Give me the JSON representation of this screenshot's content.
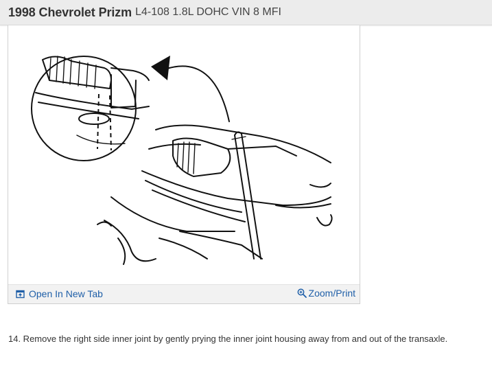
{
  "header": {
    "vehicle": "1998 Chevrolet Prizm",
    "engine": "L4-108 1.8L DOHC VIN 8 MFI"
  },
  "figure": {
    "open_in_new_tab_label": "Open In New Tab",
    "zoom_print_label": "Zoom/Print",
    "open_icon": "open-in-new-tab-icon",
    "zoom_icon": "magnifier-plus-icon"
  },
  "content": {
    "step_text": "14. Remove the right side inner joint by gently prying the inner joint housing away from and out of the transaxle."
  },
  "colors": {
    "header_bg": "#ececec",
    "link": "#1f5fa8",
    "footer_bg": "#f2f2f2"
  }
}
